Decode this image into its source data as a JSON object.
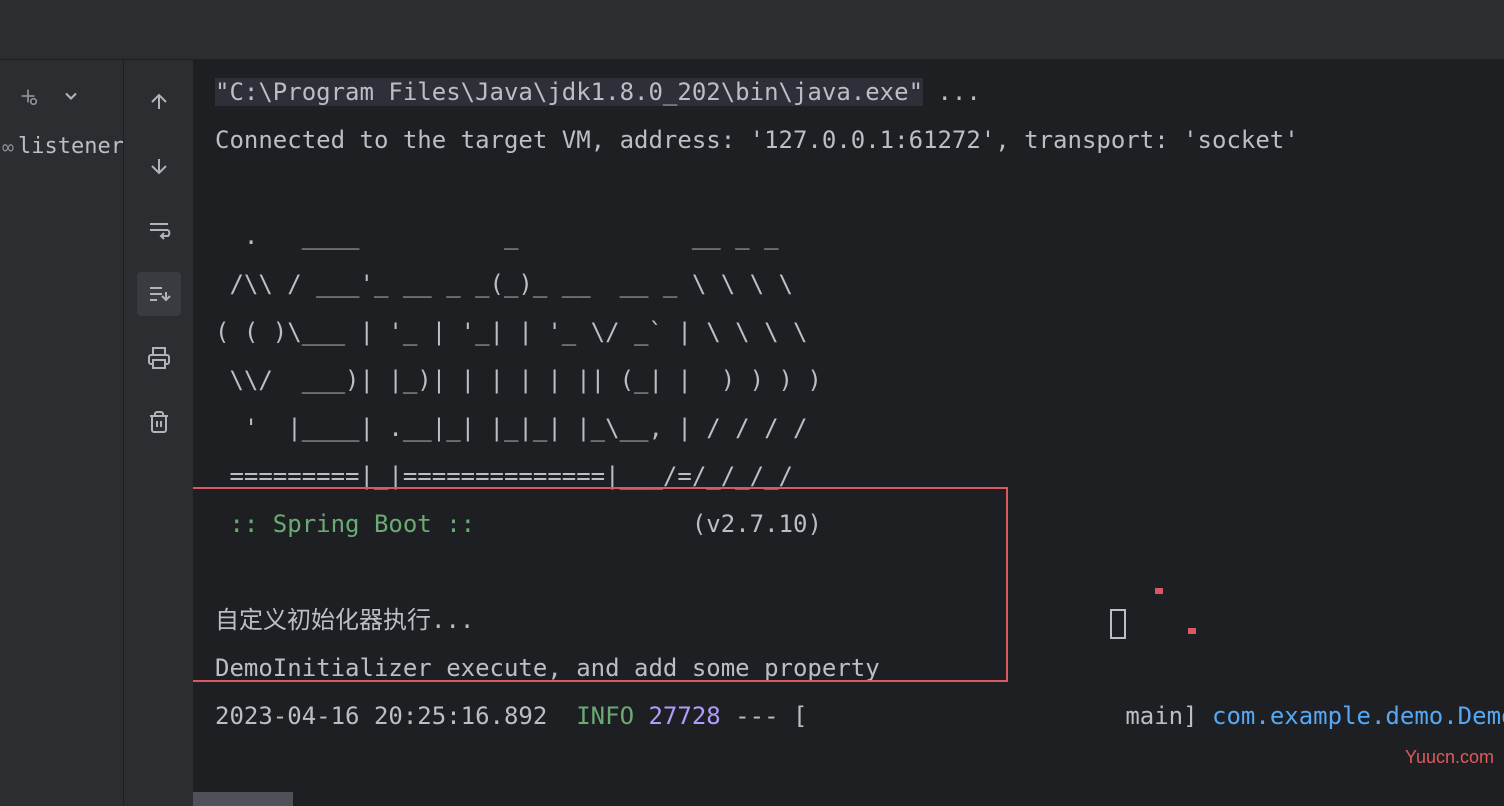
{
  "left_panel": {
    "item_label": "listener"
  },
  "console": {
    "line1_cmd": "\"C:\\Program Files\\Java\\jdk1.8.0_202\\bin\\java.exe\"",
    "line1_rest": " ...",
    "line2": "Connected to the target VM, address: '127.0.0.1:61272', transport: 'socket'",
    "ascii_art": [
      "  .   ____          _            __ _ _",
      " /\\\\ / ___'_ __ _ _(_)_ __  __ _ \\ \\ \\ \\",
      "( ( )\\___ | '_ | '_| | '_ \\/ _` | \\ \\ \\ \\",
      " \\\\/  ___)| |_)| | | | | || (_| |  ) ) ) )",
      "  '  |____| .__|_| |_|_| |_\\__, | / / / /",
      " =========|_|==============|___/=/_/_/_/"
    ],
    "spring_label": " :: Spring Boot :: ",
    "spring_version": "(v2.7.10)",
    "custom_line": "自定义初始化器执行...",
    "demo_line": "DemoInitializer execute, and add some property",
    "log_timestamp": "2023-04-16 20:25:16.892  ",
    "log_level": "INFO",
    "log_pid": " 27728",
    "log_sep": " --- [",
    "log_thread": "           main] ",
    "log_class": "com.example.demo.DemoAp"
  },
  "watermark": "Yuucn.com"
}
